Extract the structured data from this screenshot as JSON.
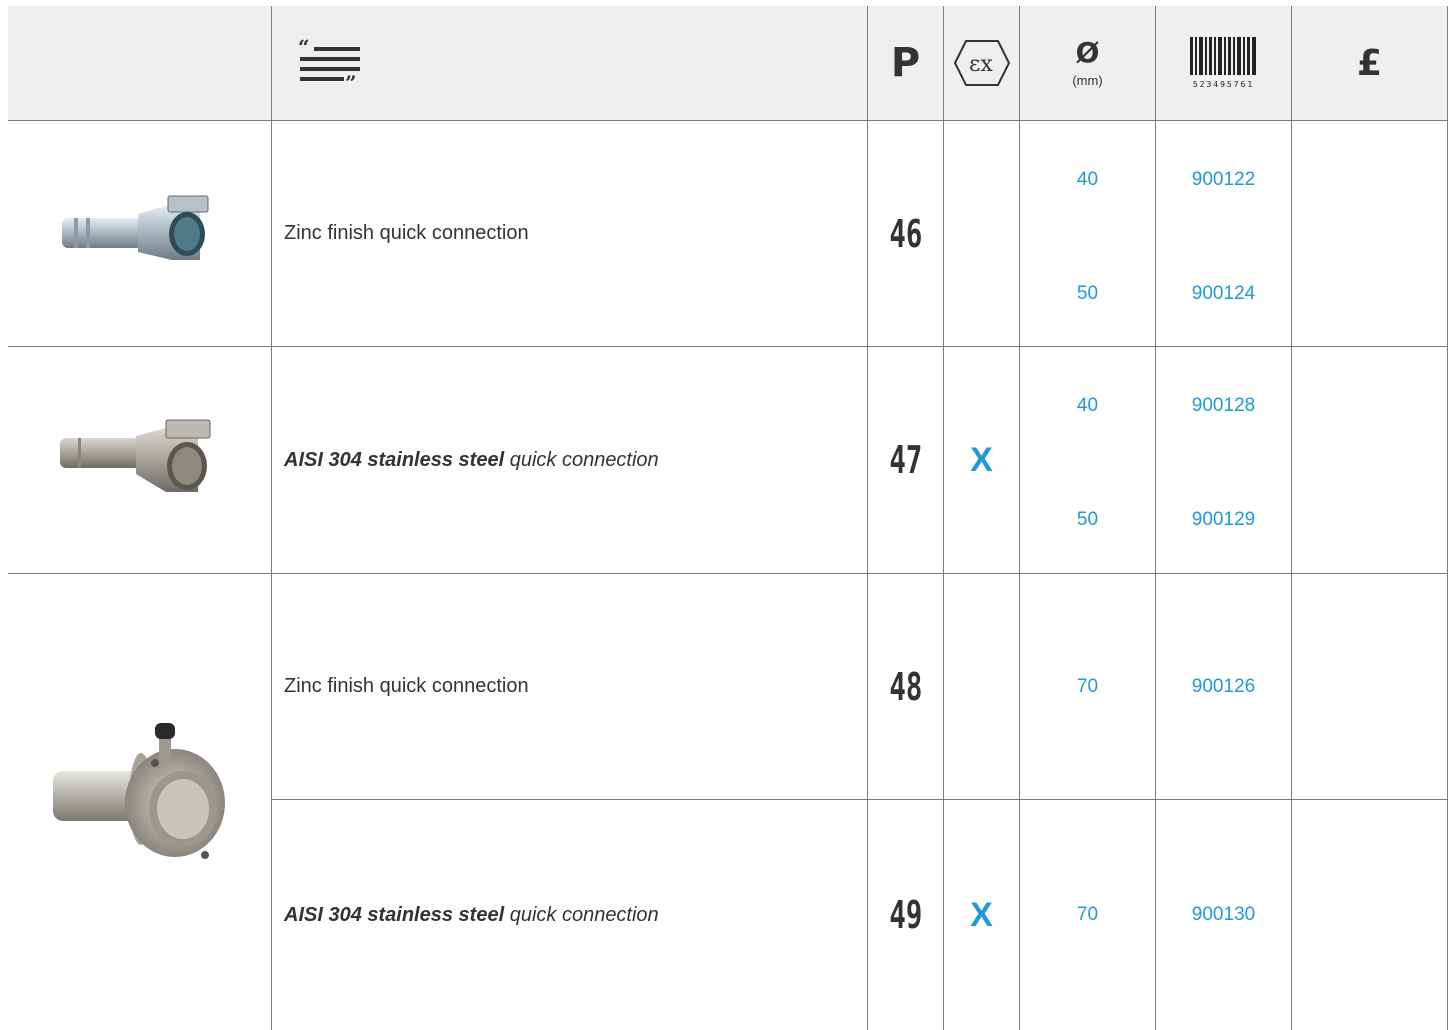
{
  "header": {
    "description_icon": "quote-lines-icon",
    "page_label": "P",
    "atex_icon": "ex-atex-icon",
    "diameter_symbol": "Ø",
    "diameter_unit": "(mm)",
    "barcode_icon": "barcode-icon",
    "barcode_digits": "523495761",
    "price_label": "£"
  },
  "rows": [
    {
      "image": "zinc-quick-connection-small-image",
      "description": "Zinc finish quick connection",
      "page": "46",
      "atex": "",
      "variants": [
        {
          "diameter": "40",
          "code": "900122"
        },
        {
          "diameter": "50",
          "code": "900124"
        }
      ]
    },
    {
      "image": "stainless-quick-connection-small-image",
      "description_bold": "AISI 304 stainless steel",
      "description_rest": " quick connection",
      "page": "47",
      "atex": "X",
      "variants": [
        {
          "diameter": "40",
          "code": "900128"
        },
        {
          "diameter": "50",
          "code": "900129"
        }
      ]
    },
    {
      "image": "flanged-quick-connection-image",
      "description": "Zinc finish quick connection",
      "page": "48",
      "atex": "",
      "variants": [
        {
          "diameter": "70",
          "code": "900126"
        }
      ]
    },
    {
      "description_bold": "AISI 304 stainless steel",
      "description_rest": " quick connection",
      "page": "49",
      "atex": "X",
      "variants": [
        {
          "diameter": "70",
          "code": "900130"
        }
      ]
    }
  ],
  "colors": {
    "accent": "#1f9ad6",
    "header_bg": "#efefef",
    "grid": "#7a7a7a",
    "text": "#333333"
  }
}
